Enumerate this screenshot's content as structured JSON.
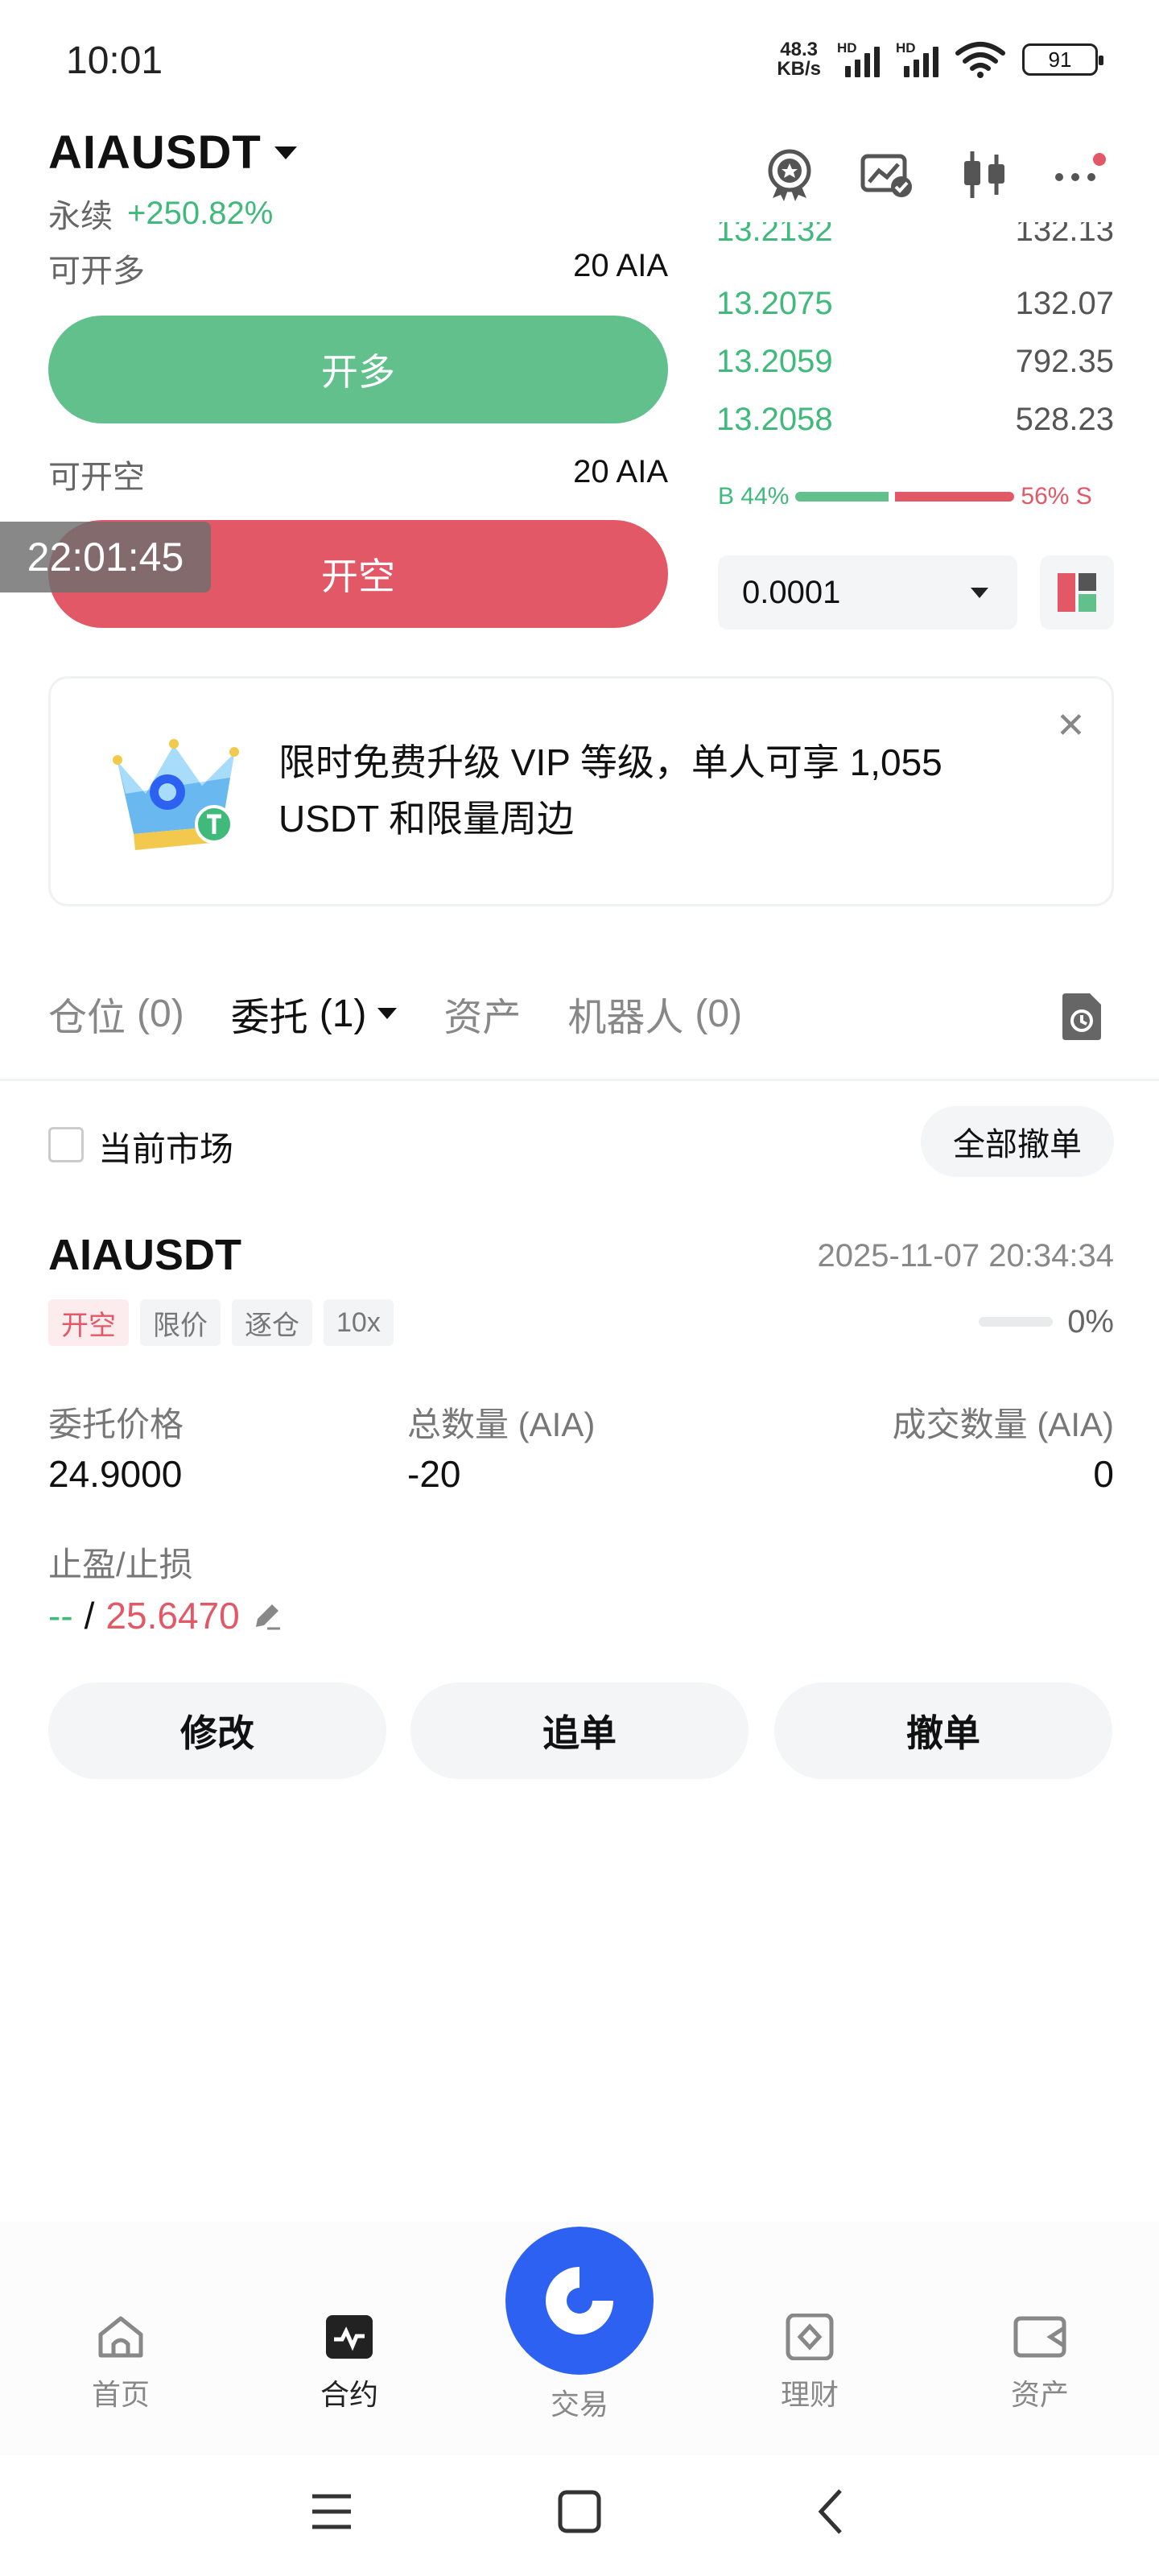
{
  "status_bar": {
    "time": "10:01",
    "speed_value": "48.3",
    "speed_unit": "KB/s",
    "hd_label": "HD",
    "battery": "91"
  },
  "header": {
    "pair": "AIAUSDT",
    "type": "永续",
    "change": "+250.82%"
  },
  "trade": {
    "long_available_label": "可开多",
    "long_available_value": "20 AIA",
    "long_button": "开多",
    "short_available_label": "可开空",
    "short_available_value": "20 AIA",
    "short_button": "开空",
    "overlay_timer": "22:01:45"
  },
  "order_book": {
    "rows": [
      {
        "price": "13.2132",
        "qty": "132.13"
      },
      {
        "price": "13.2075",
        "qty": "132.07"
      },
      {
        "price": "13.2059",
        "qty": "792.35"
      },
      {
        "price": "13.2058",
        "qty": "528.23"
      }
    ],
    "buy_ratio_label": "B 44%",
    "sell_ratio_label": "56% S",
    "buy_ratio": 0.44,
    "precision": "0.0001"
  },
  "banner": {
    "text": "限时免费升级 VIP 等级，单人可享 1,055 USDT 和限量周边",
    "close": "✕"
  },
  "tabs": [
    {
      "label": "仓位",
      "count": "(0)"
    },
    {
      "label": "委托",
      "count": "(1)"
    },
    {
      "label": "资产",
      "count": ""
    },
    {
      "label": "机器人",
      "count": "(0)"
    }
  ],
  "filter": {
    "current_market": "当前市场",
    "cancel_all": "全部撤单"
  },
  "order": {
    "symbol": "AIAUSDT",
    "time": "2025-11-07 20:34:34",
    "tags": [
      "开空",
      "限价",
      "逐仓",
      "10x"
    ],
    "fill_percent": "0%",
    "fill_fraction": 0,
    "price_label": "委托价格",
    "price_value": "24.9000",
    "total_label": "总数量 (AIA)",
    "total_value": "-20",
    "filled_label": "成交数量 (AIA)",
    "filled_value": "0",
    "tpsl_label": "止盈/止损",
    "tp_value": "--",
    "separator": "/",
    "sl_value": "25.6470",
    "btn_modify": "修改",
    "btn_chase": "追单",
    "btn_cancel": "撤单"
  },
  "bottom_nav": {
    "home": "首页",
    "futures": "合约",
    "trade": "交易",
    "earn": "理财",
    "assets": "资产"
  },
  "colors": {
    "green": "#62c08d",
    "red": "#e35866",
    "brand_blue": "#2c61f1"
  }
}
